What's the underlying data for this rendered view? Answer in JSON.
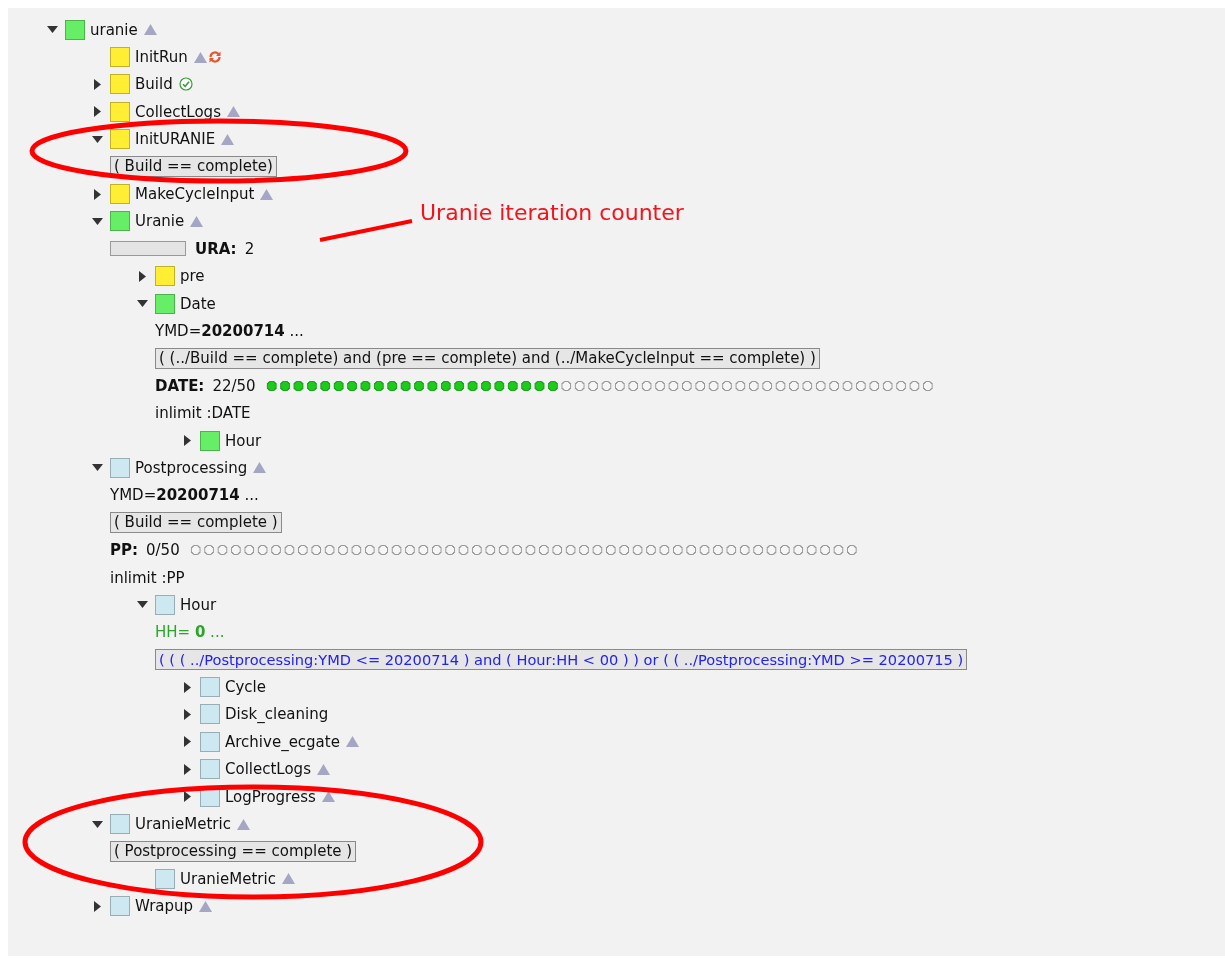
{
  "tree": [
    {
      "kind": "node",
      "name": "uranie",
      "color": "#66ee66",
      "expanded": true,
      "queued": true,
      "children": [
        {
          "kind": "node",
          "name": "InitRun",
          "color": "#ffee33",
          "queued": true,
          "rerun": true
        },
        {
          "kind": "node",
          "name": "Build",
          "color": "#ffee33",
          "expanded": false,
          "complete": true
        },
        {
          "kind": "node",
          "name": "CollectLogs",
          "color": "#ffee33",
          "expanded": false,
          "queued": true
        },
        {
          "kind": "node",
          "name": "InitURANIE",
          "color": "#ffee33",
          "expanded": true,
          "queued": true,
          "children": [
            {
              "kind": "trigger",
              "text": "( Build == complete)"
            }
          ]
        },
        {
          "kind": "node",
          "name": "MakeCycleInput",
          "color": "#ffee33",
          "expanded": false,
          "queued": true
        },
        {
          "kind": "node",
          "name": "Uranie",
          "color": "#66ee66",
          "expanded": true,
          "queued": true,
          "children": [
            {
              "kind": "meter",
              "label": "URA:",
              "value": "2"
            },
            {
              "kind": "node",
              "name": "pre",
              "color": "#ffee33",
              "expanded": false
            },
            {
              "kind": "node",
              "name": "Date",
              "color": "#66ee66",
              "expanded": true,
              "children": [
                {
                  "kind": "repeat",
                  "text": "YMD=**20200714** ..."
                },
                {
                  "kind": "trigger",
                  "text": "( (../Build == complete) and (pre == complete) and (../MakeCycleInput == complete) )"
                },
                {
                  "kind": "limit",
                  "label": "DATE:",
                  "value": "22/50",
                  "level": 0.44
                },
                {
                  "kind": "inlimit",
                  "text": "inlimit :DATE"
                },
                {
                  "kind": "node",
                  "name": "Hour",
                  "color": "#66ee66",
                  "expanded": false
                }
              ]
            }
          ]
        },
        {
          "kind": "node",
          "name": "Postprocessing",
          "color": "#cde8f0",
          "expanded": true,
          "queued": true,
          "children": [
            {
              "kind": "repeat",
              "text": "YMD=**20200714** ..."
            },
            {
              "kind": "trigger",
              "text": "( Build == complete )"
            },
            {
              "kind": "limit",
              "label": "PP:",
              "value": "0/50",
              "level": 0
            },
            {
              "kind": "inlimit",
              "text": "inlimit :PP"
            },
            {
              "kind": "node",
              "name": "Hour",
              "color": "#cde8f0",
              "expanded": true,
              "children": [
                {
                  "kind": "generated",
                  "text": "HH= **0** ..."
                },
                {
                  "kind": "trigger",
                  "active": true,
                  "text": "( ( ( ../Postprocessing:YMD <= 20200714 ) and ( Hour:HH < 00 ) ) or ( ( ../Postprocessing:YMD >= 20200715 )"
                },
                {
                  "kind": "node",
                  "name": "Cycle",
                  "color": "#cde8f0",
                  "expanded": false
                },
                {
                  "kind": "node",
                  "name": "Disk_cleaning",
                  "color": "#cde8f0",
                  "expanded": false
                },
                {
                  "kind": "node",
                  "name": "Archive_ecgate",
                  "color": "#cde8f0",
                  "expanded": false,
                  "queued": true
                },
                {
                  "kind": "node",
                  "name": "CollectLogs",
                  "color": "#cde8f0",
                  "expanded": false,
                  "queued": true
                },
                {
                  "kind": "node",
                  "name": "LogProgress",
                  "color": "#cde8f0",
                  "expanded": false,
                  "queued": true
                }
              ]
            }
          ]
        },
        {
          "kind": "node",
          "name": "UranieMetric",
          "color": "#cde8f0",
          "expanded": true,
          "queued": true,
          "children": [
            {
              "kind": "trigger",
              "text": "( Postprocessing == complete )"
            },
            {
              "kind": "node",
              "name": "UranieMetric",
              "color": "#cde8f0",
              "queued": true
            }
          ]
        },
        {
          "kind": "node",
          "name": "Wrapup",
          "color": "#cde8f0",
          "expanded": false,
          "queued": true
        }
      ]
    }
  ],
  "annotation": {
    "callout": "Uranie iteration counter"
  }
}
